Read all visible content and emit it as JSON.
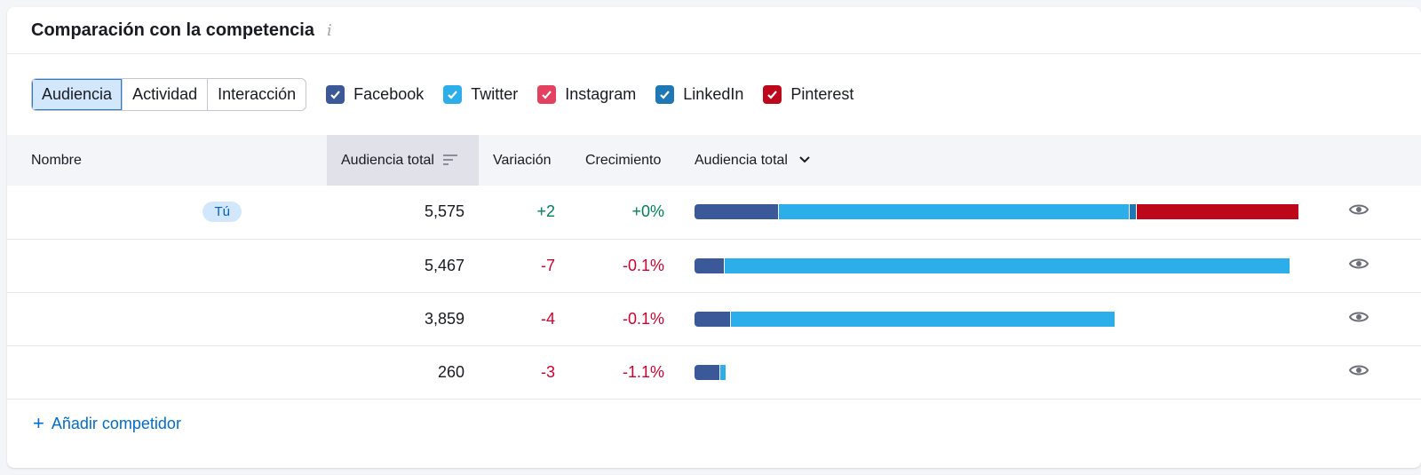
{
  "header": {
    "title": "Comparación con la competencia",
    "info_icon": "info-icon"
  },
  "metric_tabs": [
    {
      "label": "Audiencia",
      "active": true
    },
    {
      "label": "Actividad",
      "active": false
    },
    {
      "label": "Interacción",
      "active": false
    }
  ],
  "networks": [
    {
      "label": "Facebook",
      "checked": true,
      "color": "#3b5998"
    },
    {
      "label": "Twitter",
      "checked": true,
      "color": "#2baee9"
    },
    {
      "label": "Instagram",
      "checked": true,
      "color": "#e4405f"
    },
    {
      "label": "LinkedIn",
      "checked": true,
      "color": "#1f77b4"
    },
    {
      "label": "Pinterest",
      "checked": true,
      "color": "#bd081c"
    }
  ],
  "table": {
    "columns": {
      "name": "Nombre",
      "audience": "Audiencia total",
      "variation": "Variación",
      "growth": "Crecimiento",
      "audience_chart": "Audiencia total"
    },
    "rows": [
      {
        "name": "",
        "badge": "Tú",
        "audience": "5,575",
        "variation": "+2",
        "growth": "+0%",
        "trend": "pos",
        "bar": [
          {
            "network": "Facebook",
            "value": 0.14
          },
          {
            "network": "Twitter",
            "value": 0.58
          },
          {
            "network": "LinkedIn",
            "value": 0.012
          },
          {
            "network": "Pinterest",
            "value": 0.268
          }
        ]
      },
      {
        "name": "",
        "badge": "",
        "audience": "5,467",
        "variation": "-7",
        "growth": "-0.1%",
        "trend": "neg",
        "bar": [
          {
            "network": "Facebook",
            "value": 0.05
          },
          {
            "network": "Twitter",
            "value": 0.935
          }
        ]
      },
      {
        "name": "",
        "badge": "",
        "audience": "3,859",
        "variation": "-4",
        "growth": "-0.1%",
        "trend": "neg",
        "bar": [
          {
            "network": "Facebook",
            "value": 0.06
          },
          {
            "network": "Twitter",
            "value": 0.635
          }
        ]
      },
      {
        "name": "",
        "badge": "",
        "audience": "260",
        "variation": "-3",
        "growth": "-1.1%",
        "trend": "neg",
        "bar": [
          {
            "network": "Facebook",
            "value": 0.042
          },
          {
            "network": "Twitter",
            "value": 0.009
          }
        ]
      }
    ]
  },
  "footer": {
    "add_competitor": "Añadir competidor"
  }
}
